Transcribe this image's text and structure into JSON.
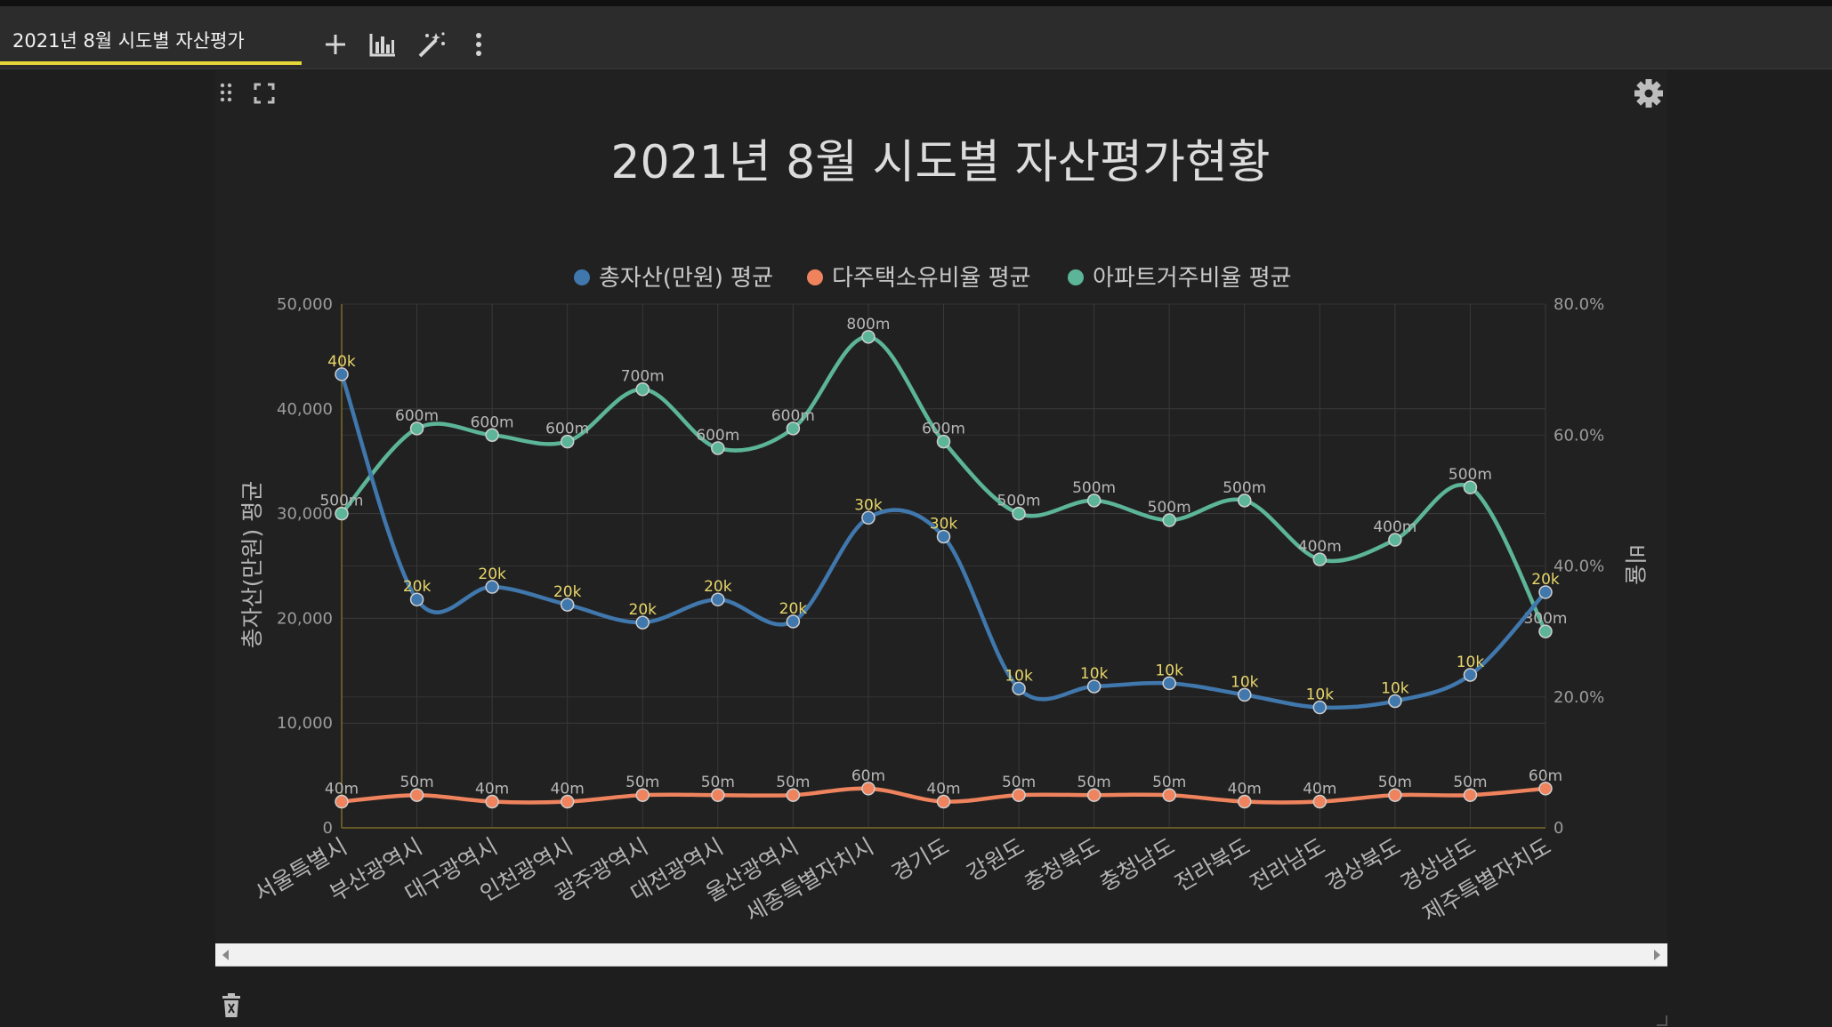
{
  "tab": {
    "title": "2021년 8월 시도별 자산평가"
  },
  "toolbar": [
    {
      "name": "add-icon"
    },
    {
      "name": "bar-chart-icon"
    },
    {
      "name": "magic-wand-icon"
    },
    {
      "name": "more-vertical-icon"
    }
  ],
  "panel_controls": [
    "drag-handle-icon",
    "expand-icon",
    "gear-icon",
    "trash-icon"
  ],
  "colors": {
    "series1": "#4077ac",
    "series2": "#ee835d",
    "series3": "#5cb598",
    "value_label_highlight": "#e8d66a",
    "value_label": "#b7b7b7",
    "tab_underline": "#e6d63a"
  },
  "chart_data": {
    "type": "line",
    "title": "2021년 8월 시도별 자산평가현황",
    "ylabel_left": "총자산(만원) 평균",
    "ylabel_right": "비율",
    "categories": [
      "서울특별시",
      "부산광역시",
      "대구광역시",
      "인천광역시",
      "광주광역시",
      "대전광역시",
      "울산광역시",
      "세종특별자치시",
      "경기도",
      "강원도",
      "충청북도",
      "충청남도",
      "전라북도",
      "전라남도",
      "경상북도",
      "경상남도",
      "제주특별자치도"
    ],
    "y_left": {
      "min": 0,
      "max": 50000,
      "ticks": [
        "0",
        "10,000",
        "20,000",
        "30,000",
        "40,000",
        "50,000"
      ]
    },
    "y_right": {
      "min": 0,
      "max": 0.8,
      "ticks": [
        "0",
        "20.0%",
        "40.0%",
        "60.0%",
        "80.0%"
      ]
    },
    "legend": {
      "position": "top-center",
      "items": [
        "총자산(만원) 평균",
        "다주택소유비율 평균",
        "아파트거주비율 평균"
      ]
    },
    "grid": true,
    "series": [
      {
        "name": "총자산(만원) 평균",
        "axis": "left",
        "color": "#4077ac",
        "values": [
          43300,
          21800,
          23000,
          21300,
          19600,
          21800,
          19700,
          29600,
          27800,
          13300,
          13500,
          13800,
          12700,
          11500,
          12100,
          14600,
          22500
        ],
        "labels": [
          "40k",
          "20k",
          "20k",
          "20k",
          "20k",
          "20k",
          "20k",
          "30k",
          "30k",
          "10k",
          "10k",
          "10k",
          "10k",
          "10k",
          "10k",
          "10k",
          "20k"
        ]
      },
      {
        "name": "다주택소유비율 평균",
        "axis": "right",
        "color": "#ee835d",
        "values": [
          0.04,
          0.05,
          0.04,
          0.04,
          0.05,
          0.05,
          0.05,
          0.06,
          0.04,
          0.05,
          0.05,
          0.05,
          0.04,
          0.04,
          0.05,
          0.05,
          0.06
        ],
        "labels": [
          "40m",
          "50m",
          "40m",
          "40m",
          "50m",
          "50m",
          "50m",
          "60m",
          "40m",
          "50m",
          "50m",
          "50m",
          "40m",
          "40m",
          "50m",
          "50m",
          "60m"
        ]
      },
      {
        "name": "아파트거주비율 평균",
        "axis": "right",
        "color": "#5cb598",
        "values": [
          0.48,
          0.61,
          0.6,
          0.59,
          0.67,
          0.58,
          0.61,
          0.75,
          0.59,
          0.48,
          0.5,
          0.47,
          0.5,
          0.41,
          0.44,
          0.52,
          0.3
        ],
        "labels": [
          "500m",
          "600m",
          "600m",
          "600m",
          "700m",
          "600m",
          "600m",
          "800m",
          "600m",
          "500m",
          "500m",
          "500m",
          "500m",
          "400m",
          "400m",
          "500m",
          "300m"
        ]
      }
    ]
  }
}
